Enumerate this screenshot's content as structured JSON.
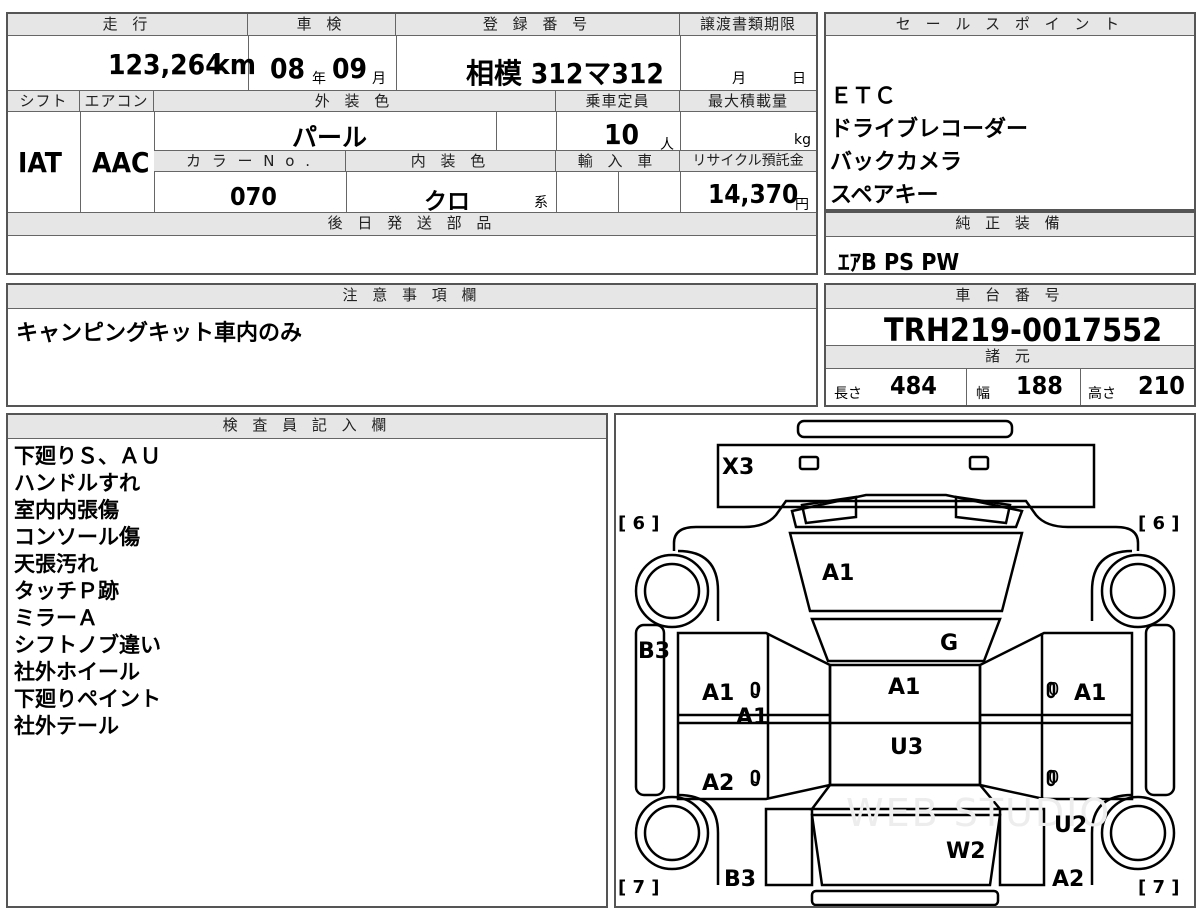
{
  "summary": {
    "headers": {
      "mileage": "走 行",
      "inspection": "車 検",
      "registration": "登 録 番 号",
      "transfer": "譲渡書類期限",
      "shift": "シフト",
      "aircon": "エアコン",
      "exterior_color": "外 装 色",
      "capacity": "乗車定員",
      "max_load": "最大積載量",
      "color_no": "カ ラ ー N o .",
      "interior_color": "内 装 色",
      "import": "輸 入 車",
      "recycle": "リサイクル預託金",
      "later_parts": "後 日 発 送 部 品"
    },
    "mileage_value": "123,264",
    "mileage_unit": "km",
    "inspection_year": "08",
    "inspection_year_unit": "年",
    "inspection_month": "09",
    "inspection_month_unit": "月",
    "registration_value": "相模 312マ312",
    "transfer_month_unit": "月",
    "transfer_day_unit": "日",
    "shift_value": "IAT",
    "aircon_value": "AAC",
    "exterior_color_value": "パール",
    "capacity_value": "10",
    "capacity_unit": "人",
    "max_load_unit": "kg",
    "color_no_value": "070",
    "interior_color_value": "クロ",
    "interior_color_unit": "系",
    "recycle_value": "14,370",
    "recycle_unit": "円"
  },
  "sales_points": {
    "header": "セ ー ル ス ポ イ ン ト",
    "items": [
      "ＥＴＣ",
      "ドライブレコーダー",
      "バックカメラ",
      "スペアキー"
    ]
  },
  "genuine_equipment": {
    "header": "純 正 装 備",
    "value": "ｴｱB PS PW"
  },
  "notes": {
    "header": "注 意 事 項 欄",
    "value": "キャンピングキット車内のみ"
  },
  "chassis": {
    "header": "車 台 番 号",
    "value": "TRH219-0017552"
  },
  "specs": {
    "header": "諸 元",
    "length_label": "長さ",
    "length_value": "484",
    "width_label": "幅",
    "width_value": "188",
    "height_label": "高さ",
    "height_value": "210"
  },
  "inspector": {
    "header": "検 査 員 記 入 欄",
    "items": [
      "下廻りＳ、ＡＵ",
      "ハンドルすれ",
      "室内内張傷",
      "コンソール傷",
      "天張汚れ",
      "タッチＰ跡",
      "ミラーＡ",
      "シフトノブ違い",
      "社外ホイール",
      "下廻りペイント",
      "社外テール"
    ]
  },
  "diagram": {
    "marks": {
      "top": "X3",
      "bracket_tl": "[ 6 ]",
      "bracket_tr": "[ 6 ]",
      "bracket_bl": "[ 7 ]",
      "bracket_br": "[ 7 ]",
      "hood": "A1",
      "left_side": "B3",
      "glass": "G",
      "left_front_door": "A1",
      "left_front_door_inner": "A1",
      "roof": "A1",
      "right_front_door": "A1",
      "roof_rear": "U3",
      "left_rear_door": "A2",
      "right_rear": "U2",
      "tailgate": "W2",
      "left_bottom": "B3",
      "right_bottom": "A2",
      "zero": "0"
    },
    "watermark": "WEB STUDIO"
  }
}
